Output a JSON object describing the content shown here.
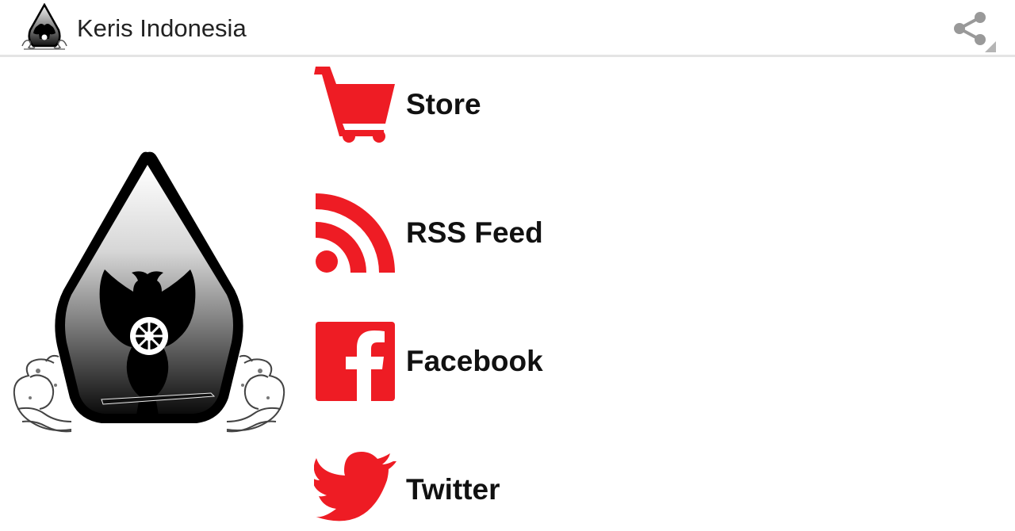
{
  "app": {
    "title": "Keris Indonesia"
  },
  "toolbar": {
    "share_icon": "share-icon"
  },
  "menu": {
    "items": [
      {
        "label": "Store",
        "icon": "shopping-cart-icon"
      },
      {
        "label": "RSS Feed",
        "icon": "rss-icon"
      },
      {
        "label": "Facebook",
        "icon": "facebook-icon"
      },
      {
        "label": "Twitter",
        "icon": "twitter-bird-icon"
      }
    ]
  },
  "colors": {
    "accent": "#ee1c24",
    "text": "#111111",
    "divider": "#e4e4e4"
  }
}
